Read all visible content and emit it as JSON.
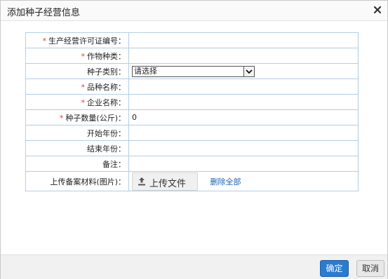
{
  "dialog": {
    "title": "添加种子经营信息"
  },
  "form": {
    "fields": [
      {
        "label": "生产经营许可证编号：",
        "required": true,
        "value": ""
      },
      {
        "label": "作物种类：",
        "required": true,
        "value": ""
      },
      {
        "label": "种子类别：",
        "required": false,
        "type": "select",
        "value": "请选择"
      },
      {
        "label": "品种名称：",
        "required": true,
        "value": ""
      },
      {
        "label": "企业名称：",
        "required": true,
        "value": ""
      },
      {
        "label": "种子数量(公斤)：",
        "required": true,
        "value": "0"
      },
      {
        "label": "开始年份：",
        "required": false,
        "value": ""
      },
      {
        "label": "结束年份：",
        "required": false,
        "value": ""
      },
      {
        "label": "备注：",
        "required": false,
        "value": ""
      }
    ],
    "upload": {
      "label": "上传备案材料(图片)：",
      "button_label": "上传文件",
      "delete_all_label": "删除全部"
    },
    "required_mark": "*"
  },
  "footer": {
    "ok_label": "确定",
    "cancel_label": "取消"
  },
  "icons": {
    "close": "close-icon",
    "upload": "upload-icon",
    "select_arrow": "chevron-down-icon"
  },
  "colors": {
    "required": "#e53b3b",
    "primary": "#2b7bd0",
    "link": "#1a62b3",
    "table_border": "#b5cde3"
  }
}
